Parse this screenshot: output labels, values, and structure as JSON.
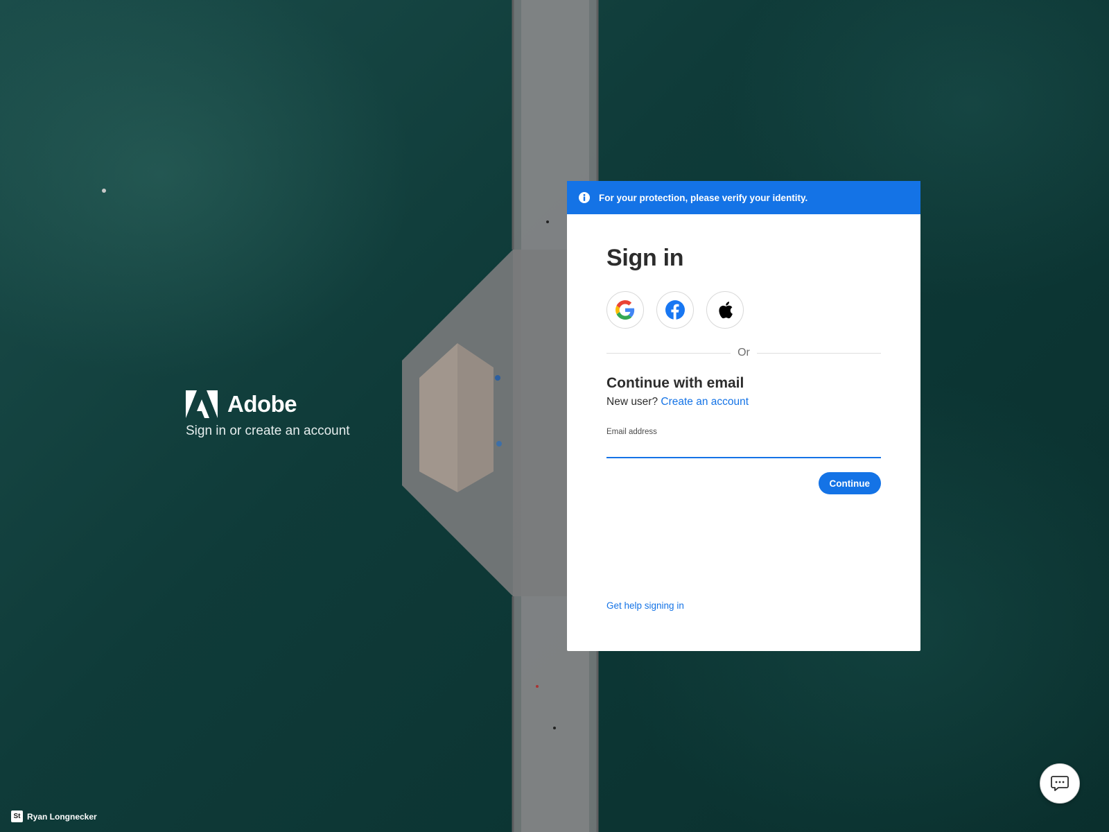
{
  "brand": {
    "name": "Adobe",
    "tagline": "Sign in or create an account",
    "logo_icon": "adobe-logo-icon"
  },
  "banner": {
    "icon": "info-icon",
    "text": "For your protection, please verify your identity."
  },
  "signin": {
    "title": "Sign in",
    "social": [
      {
        "name": "google",
        "icon": "google-icon"
      },
      {
        "name": "facebook",
        "icon": "facebook-icon"
      },
      {
        "name": "apple",
        "icon": "apple-icon"
      }
    ],
    "divider_text": "Or",
    "subtitle": "Continue with email",
    "new_user_text": "New user?",
    "create_account_link": "Create an account",
    "email_label": "Email address",
    "email_value": "",
    "continue_label": "Continue",
    "help_link": "Get help signing in"
  },
  "credit": {
    "badge": "St",
    "author": "Ryan Longnecker"
  },
  "chat": {
    "icon": "chat-icon"
  },
  "colors": {
    "accent": "#1473e6",
    "card_bg": "#ffffff",
    "title_text": "#2c2c2c",
    "water": "#0f3b39"
  }
}
